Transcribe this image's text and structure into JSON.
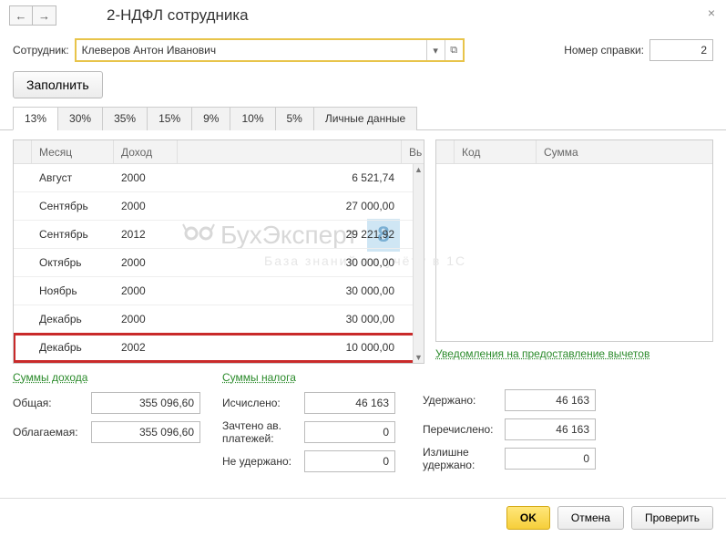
{
  "title": "2-НДФЛ сотрудника",
  "nav": {
    "back": "←",
    "fwd": "→"
  },
  "close": "×",
  "employee": {
    "label": "Сотрудник:",
    "value": "Клеверов Антон Иванович",
    "dropdown": "▾",
    "popout": "⧉"
  },
  "refnum": {
    "label": "Номер справки:",
    "value": "2"
  },
  "fill_btn": "Заполнить",
  "tabs": [
    "13%",
    "30%",
    "35%",
    "15%",
    "9%",
    "10%",
    "5%",
    "Личные данные"
  ],
  "grid": {
    "headers": {
      "month": "Месяц",
      "income": "Доход",
      "amount": "Вь"
    },
    "rows": [
      {
        "month": "Август",
        "code": "2000",
        "amount": "6 521,74"
      },
      {
        "month": "Сентябрь",
        "code": "2000",
        "amount": "27 000,00"
      },
      {
        "month": "Сентябрь",
        "code": "2012",
        "amount": "29 221,92"
      },
      {
        "month": "Октябрь",
        "code": "2000",
        "amount": "30 000,00"
      },
      {
        "month": "Ноябрь",
        "code": "2000",
        "amount": "30 000,00"
      },
      {
        "month": "Декабрь",
        "code": "2000",
        "amount": "30 000,00"
      },
      {
        "month": "Декабрь",
        "code": "2002",
        "amount": "10 000,00",
        "highlight": true
      }
    ]
  },
  "grid2": {
    "headers": {
      "code": "Код",
      "sum": "Сумма"
    }
  },
  "link": "Уведомления на предоставление вычетов",
  "income_totals": {
    "title": "Суммы дохода",
    "total_lbl": "Общая:",
    "total_val": "355 096,60",
    "taxable_lbl": "Облагаемая:",
    "taxable_val": "355 096,60"
  },
  "tax_totals": {
    "title": "Суммы налога",
    "calc_lbl": "Исчислено:",
    "calc_val": "46 163",
    "offset_lbl": "Зачтено ав. платежей:",
    "offset_val": "0",
    "notheld_lbl": "Не удержано:",
    "notheld_val": "0",
    "held_lbl": "Удержано:",
    "held_val": "46 163",
    "transf_lbl": "Перечислено:",
    "transf_val": "46 163",
    "overheld_lbl": "Излишне удержано:",
    "overheld_val": "0"
  },
  "footer": {
    "ok": "OK",
    "cancel": "Отмена",
    "check": "Проверить"
  },
  "watermark": {
    "text": "БухЭксперт",
    "badge": "8",
    "sub": "База  знаний  по  учёту  в  1С"
  }
}
